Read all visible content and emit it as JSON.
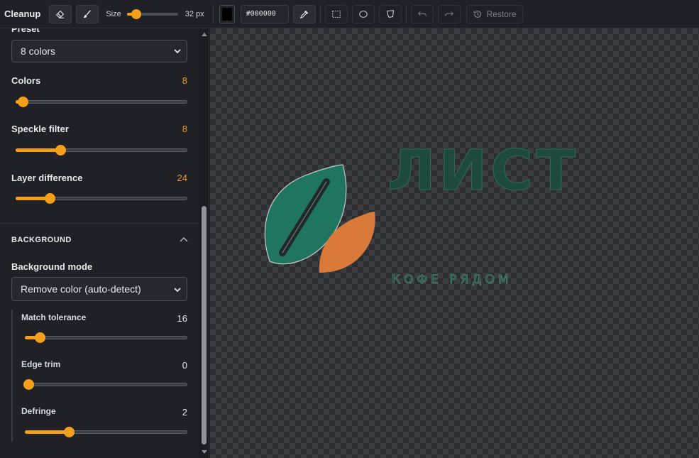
{
  "toolbar": {
    "title": "Cleanup",
    "size_label": "Size",
    "size_value": "32 px",
    "size_fraction": 0.18,
    "color_hex": "#000000",
    "restore_label": "Restore",
    "icons": [
      "eraser-icon",
      "brush-icon",
      "eyedropper-icon",
      "rect-select-icon",
      "ellipse-select-icon",
      "lasso-select-icon",
      "undo-icon",
      "redo-icon",
      "history-icon"
    ]
  },
  "sidebar": {
    "preset": {
      "label": "Preset",
      "value": "8 colors"
    },
    "colors": {
      "label": "Colors",
      "value": "8",
      "fraction": 0.04
    },
    "speckle": {
      "label": "Speckle filter",
      "value": "8",
      "fraction": 0.26
    },
    "layer_diff": {
      "label": "Layer difference",
      "value": "24",
      "fraction": 0.2
    },
    "background": {
      "section_title": "BACKGROUND",
      "mode_label": "Background mode",
      "mode_value": "Remove color (auto-detect)",
      "match_tolerance": {
        "label": "Match tolerance",
        "value": "16",
        "fraction": 0.09
      },
      "edge_trim": {
        "label": "Edge trim",
        "value": "0",
        "fraction": 0.0
      },
      "defringe": {
        "label": "Defringe",
        "value": "2",
        "fraction": 0.27
      }
    }
  },
  "canvas": {
    "logo_word": "ЛИСТ",
    "logo_tagline": "КОФЕ РЯДОМ",
    "colors": {
      "leaf_green": "#1f7560",
      "leaf_orange": "#d9793a",
      "text_green": "#1d4a3c",
      "accent": "#f5a01a"
    }
  }
}
